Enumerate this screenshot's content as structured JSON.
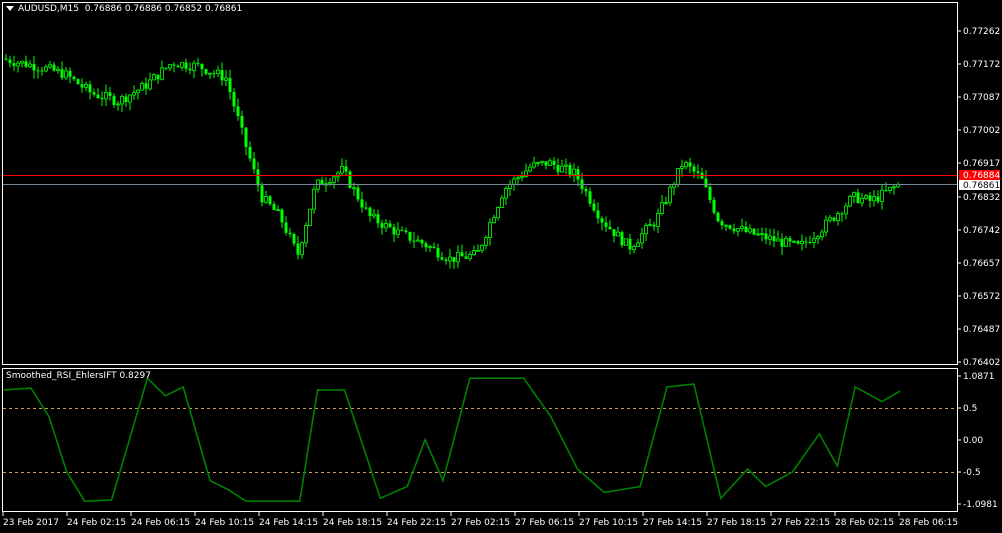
{
  "header": {
    "symbol": "AUDUSD,M15",
    "open": "0.76886",
    "high": "0.76886",
    "low": "0.76852",
    "close": "0.76861"
  },
  "indicator": {
    "name": "Smoothed_RSI_EhlersIFT",
    "value": "0.8297"
  },
  "colors": {
    "background": "#000000",
    "candle": "#00ff00",
    "indicator_line": "#008000",
    "bid_line": "#ff0000",
    "ask_line": "#778899",
    "level_line": "#c8a060"
  },
  "price_axis": {
    "ticks": [
      "0.77262",
      "0.77172",
      "0.77087",
      "0.77002",
      "0.76917",
      "0.76832",
      "0.76742",
      "0.76657",
      "0.76572",
      "0.76487",
      "0.76402"
    ],
    "bid_label": "0.76884",
    "current_label": "0.76861"
  },
  "indicator_axis": {
    "ticks": [
      "1.0871",
      "0.5",
      "0.00",
      "-0.5",
      "-1.0981"
    ]
  },
  "time_axis": {
    "ticks": [
      "23 Feb 2017",
      "24 Feb 02:15",
      "24 Feb 06:15",
      "24 Feb 10:15",
      "24 Feb 14:15",
      "24 Feb 18:15",
      "24 Feb 22:15",
      "27 Feb 02:15",
      "27 Feb 06:15",
      "27 Feb 10:15",
      "27 Feb 14:15",
      "27 Feb 18:15",
      "27 Feb 22:15",
      "28 Feb 02:15",
      "28 Feb 06:15"
    ]
  },
  "chart_data": [
    {
      "type": "candlestick",
      "ylim": [
        0.76402,
        0.77262
      ],
      "price_path": [
        [
          0.0,
          0.7719
        ],
        [
          0.04,
          0.7717
        ],
        [
          0.07,
          0.7715
        ],
        [
          0.1,
          0.771
        ],
        [
          0.13,
          0.7708
        ],
        [
          0.16,
          0.7712
        ],
        [
          0.19,
          0.7718
        ],
        [
          0.22,
          0.7717
        ],
        [
          0.25,
          0.7714
        ],
        [
          0.27,
          0.7698
        ],
        [
          0.29,
          0.7683
        ],
        [
          0.31,
          0.7678
        ],
        [
          0.33,
          0.7668
        ],
        [
          0.35,
          0.7686
        ],
        [
          0.38,
          0.769
        ],
        [
          0.41,
          0.7678
        ],
        [
          0.44,
          0.7674
        ],
        [
          0.47,
          0.7671
        ],
        [
          0.5,
          0.7667
        ],
        [
          0.53,
          0.7668
        ],
        [
          0.56,
          0.7685
        ],
        [
          0.59,
          0.7691
        ],
        [
          0.61,
          0.7692
        ],
        [
          0.64,
          0.7689
        ],
        [
          0.67,
          0.7677
        ],
        [
          0.7,
          0.767
        ],
        [
          0.73,
          0.7677
        ],
        [
          0.76,
          0.7692
        ],
        [
          0.78,
          0.7688
        ],
        [
          0.8,
          0.7677
        ],
        [
          0.83,
          0.7674
        ],
        [
          0.86,
          0.7672
        ],
        [
          0.89,
          0.767
        ],
        [
          0.92,
          0.7676
        ],
        [
          0.95,
          0.7683
        ],
        [
          0.97,
          0.7682
        ],
        [
          1.0,
          0.76861
        ]
      ]
    },
    {
      "type": "line",
      "series": [
        {
          "values": [
            [
              0.0,
              0.85
            ],
            [
              0.03,
              0.88
            ],
            [
              0.05,
              0.4
            ],
            [
              0.07,
              -0.55
            ],
            [
              0.09,
              -1.05
            ],
            [
              0.12,
              -1.03
            ],
            [
              0.14,
              0.0
            ],
            [
              0.16,
              1.05
            ],
            [
              0.18,
              0.75
            ],
            [
              0.2,
              0.9
            ],
            [
              0.23,
              -0.7
            ],
            [
              0.25,
              -0.85
            ],
            [
              0.27,
              -1.05
            ],
            [
              0.33,
              -1.05
            ],
            [
              0.35,
              0.85
            ],
            [
              0.38,
              0.85
            ],
            [
              0.42,
              -1.0
            ],
            [
              0.45,
              -0.8
            ],
            [
              0.47,
              0.0
            ],
            [
              0.49,
              -0.7
            ],
            [
              0.52,
              1.05
            ],
            [
              0.58,
              1.05
            ],
            [
              0.61,
              0.4
            ],
            [
              0.64,
              -0.5
            ],
            [
              0.67,
              -0.9
            ],
            [
              0.71,
              -0.8
            ],
            [
              0.74,
              0.9
            ],
            [
              0.77,
              0.95
            ],
            [
              0.8,
              -1.0
            ],
            [
              0.83,
              -0.5
            ],
            [
              0.85,
              -0.8
            ],
            [
              0.88,
              -0.55
            ],
            [
              0.91,
              0.1
            ],
            [
              0.93,
              -0.45
            ],
            [
              0.95,
              0.9
            ],
            [
              0.98,
              0.65
            ],
            [
              1.0,
              0.83
            ]
          ]
        }
      ],
      "levels": [
        0.5,
        -0.5
      ],
      "ylim": [
        -1.0981,
        1.0871
      ]
    }
  ]
}
